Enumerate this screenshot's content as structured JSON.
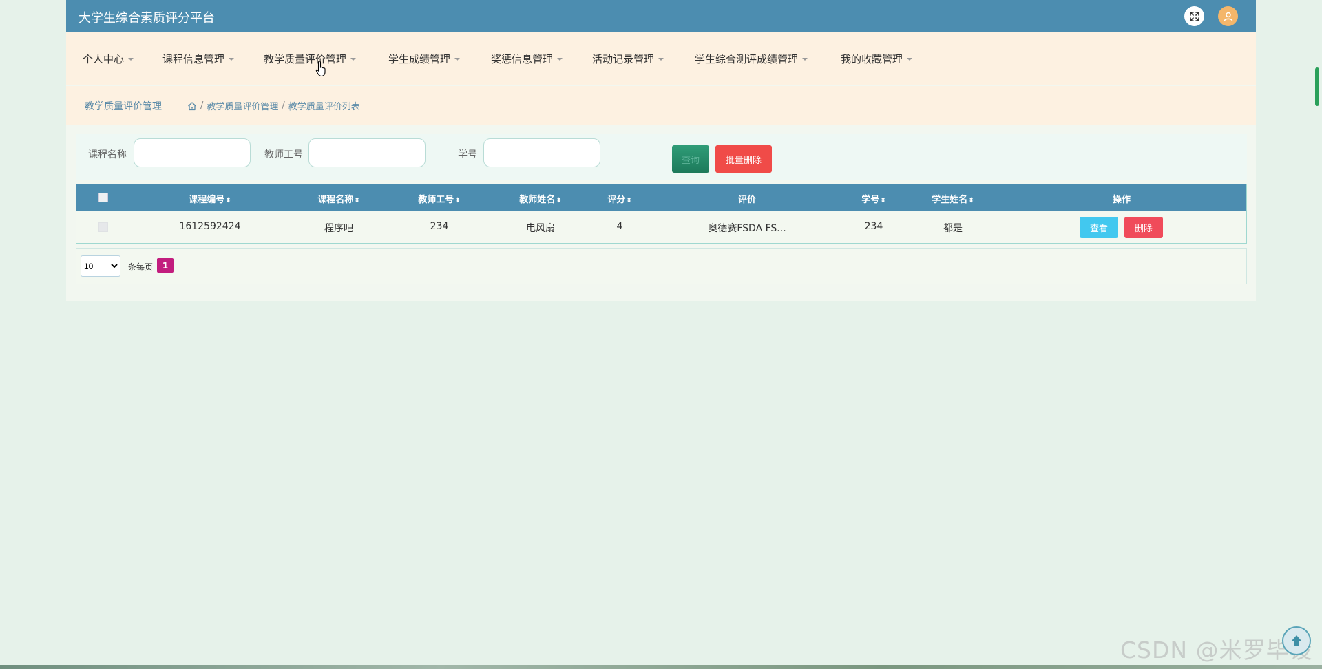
{
  "header": {
    "title": "大学生综合素质评分平台",
    "fullscreen_icon": "expand-icon",
    "avatar_icon": "user-icon"
  },
  "nav": {
    "items": [
      {
        "label": "个人中心"
      },
      {
        "label": "课程信息管理"
      },
      {
        "label": "教学质量评价管理"
      },
      {
        "label": "学生成绩管理"
      },
      {
        "label": "奖惩信息管理"
      },
      {
        "label": "活动记录管理"
      },
      {
        "label": "学生综合测评成绩管理"
      },
      {
        "label": "我的收藏管理"
      }
    ]
  },
  "breadcrumb": {
    "title": "教学质量评价管理",
    "home_icon": "home-icon",
    "separator": "/",
    "level1": "教学质量评价管理",
    "level2": "教学质量评价列表"
  },
  "search": {
    "course_name_label": "课程名称",
    "course_name_value": "",
    "teacher_id_label": "教师工号",
    "teacher_id_value": "",
    "student_id_label": "学号",
    "student_id_value": "",
    "search_button": "查询",
    "batch_delete_button": "批量删除"
  },
  "table": {
    "sort_glyph": "⬍",
    "headers": {
      "course_code": "课程编号",
      "course_name": "课程名称",
      "teacher_id": "教师工号",
      "teacher_name": "教师姓名",
      "score": "评分",
      "evaluation": "评价",
      "student_id": "学号",
      "student_name": "学生姓名",
      "actions": "操作"
    },
    "rows": [
      {
        "course_code": "1612592424",
        "course_name": "程序吧",
        "teacher_id": "234",
        "teacher_name": "电风扇",
        "score": "4",
        "evaluation": "奥德赛FSDA FS...",
        "student_id": "234",
        "student_name": "都是",
        "view_button": "查看",
        "delete_button": "删除"
      }
    ]
  },
  "pagination": {
    "page_size": "10",
    "page_size_options": [
      "10"
    ],
    "per_page_label": "条每页",
    "current_page": "1"
  },
  "watermark": "CSDN @米罗毕设",
  "colors": {
    "header_bg": "#4c8db0",
    "nav_bg": "#fdf1e1",
    "page_bg": "#e6f2ea",
    "danger": "#f04b48",
    "info": "#42c8ef",
    "page_active": "#c21d7e"
  }
}
